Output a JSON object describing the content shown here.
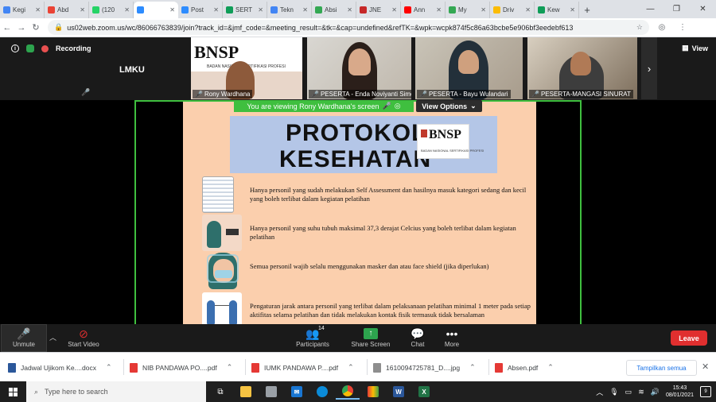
{
  "browser": {
    "tabs": [
      {
        "title": "Kegi",
        "color": "#4285f4"
      },
      {
        "title": "Abd",
        "color": "#ea4335"
      },
      {
        "title": "(120",
        "color": "#25d366"
      },
      {
        "title": "",
        "color": "#2d8cff",
        "active": true
      },
      {
        "title": "Post",
        "color": "#2d8cff"
      },
      {
        "title": "SERT",
        "color": "#0f9d58"
      },
      {
        "title": "Tekn",
        "color": "#4285f4"
      },
      {
        "title": "Absi",
        "color": "#34a853"
      },
      {
        "title": "JNE",
        "color": "#c62828"
      },
      {
        "title": "Ann",
        "color": "#ff0000"
      },
      {
        "title": "My",
        "color": "#34a853"
      },
      {
        "title": "Driv",
        "color": "#fbbc04"
      },
      {
        "title": "Kew",
        "color": "#0f9d58"
      }
    ],
    "url": "us02web.zoom.us/wc/86066763839/join?track_id=&jmf_code=&meeting_result=&tk=&cap=undefined&refTK=&wpk=wcpk874f5c86a63bcbe5e906bf3eedebf613"
  },
  "zoom": {
    "recording_label": "Recording",
    "host_tile_name": "LMKU",
    "view_label": "View",
    "participants": [
      {
        "name": "Rony Wardhana"
      },
      {
        "name": "PESERTA - Enda Noviyanti Simo..."
      },
      {
        "name": "PESERTA - Bayu Wulandari"
      },
      {
        "name": "PESERTA-MANGASI SINURAT"
      }
    ],
    "banner": "You are viewing Rony Wardhana's screen",
    "view_options": "View Options",
    "participant_count": "14",
    "toolbar": {
      "unmute": "Unmute",
      "start_video": "Start Video",
      "participants": "Participants",
      "share_screen": "Share Screen",
      "chat": "Chat",
      "more": "More",
      "leave": "Leave"
    }
  },
  "slide": {
    "title_line1": "PROTOKOL",
    "title_line2": "KESEHATAN",
    "logo_text": "BNSP",
    "logo_sub": "BADAN NASIONAL SERTIFIKASI PROFESI",
    "tile_logo_text": "BNSP",
    "tile_logo_sub": "BADAN NASIONAL SERTIFIKASI PROFESI",
    "items": [
      "Hanya personil yang sudah melakukan Self Assessment dan hasilnya masuk kategori sedang dan kecil yang boleh terlibat dalam kegiatan pelatihan",
      "Hanya personil yang suhu tubuh maksimal 37,3 derajat Celcius yang boleh terlibat dalam kegiatan pelatihan",
      "Semua personil wajib selalu menggunakan masker dan atau face shield (jika diperlukan)",
      "Pengaturan jarak antara personil yang terlibat dalam pelaksanaan pelatihan minimal 1 meter pada setiap aktifitas selama pelatihan dan tidak melakukan kontak fisik termasuk tidak bersalaman"
    ]
  },
  "downloads": {
    "items": [
      {
        "name": "Jadwal Ujikom Ke....docx",
        "type": "docx",
        "color": "#2b579a"
      },
      {
        "name": "NIB PANDAWA PO....pdf",
        "type": "pdf",
        "color": "#e53935"
      },
      {
        "name": "IUMK PANDAWA P....pdf",
        "type": "pdf",
        "color": "#e53935"
      },
      {
        "name": "1610094725781_D....jpg",
        "type": "jpg",
        "color": "#8e8e8e"
      },
      {
        "name": "Absen.pdf",
        "type": "pdf",
        "color": "#e53935"
      }
    ],
    "show_all": "Tampilkan semua"
  },
  "taskbar": {
    "search_placeholder": "Type here to search",
    "time": "15:43",
    "date": "08/01/2021",
    "notifications": "9"
  }
}
